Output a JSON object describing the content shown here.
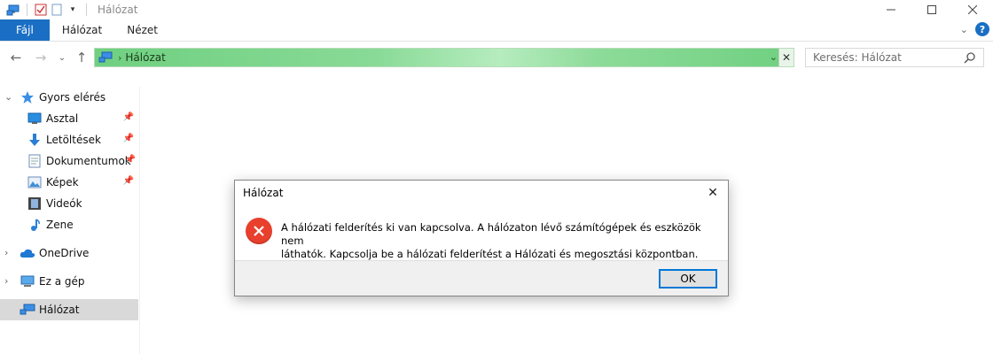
{
  "window": {
    "title": "Hálózat"
  },
  "ribbon": {
    "tabs": [
      {
        "label": "Fájl"
      },
      {
        "label": "Hálózat"
      },
      {
        "label": "Nézet"
      }
    ]
  },
  "address": {
    "location": "Hálózat",
    "search_placeholder": "Keresés: Hálózat"
  },
  "nav": {
    "quick_access": "Gyors elérés",
    "pinned": [
      {
        "label": "Asztal",
        "icon": "desktop-icon"
      },
      {
        "label": "Letöltések",
        "icon": "download-icon"
      },
      {
        "label": "Dokumentumok",
        "icon": "document-icon"
      },
      {
        "label": "Képek",
        "icon": "pictures-icon"
      },
      {
        "label": "Videók",
        "icon": "video-icon"
      },
      {
        "label": "Zene",
        "icon": "music-icon"
      }
    ],
    "onedrive": "OneDrive",
    "this_pc": "Ez a gép",
    "network": "Hálózat"
  },
  "dialog": {
    "title": "Hálózat",
    "message_line1": "A hálózati felderítés ki van kapcsolva. A hálózaton lévő számítógépek és eszközök nem",
    "message_line2": "láthatók. Kapcsolja be a hálózati felderítést a Hálózati és megosztási központban.",
    "ok_label": "OK"
  },
  "colors": {
    "accent": "#1a6fc4",
    "address_bar": "#88da96",
    "error": "#e8402d"
  }
}
